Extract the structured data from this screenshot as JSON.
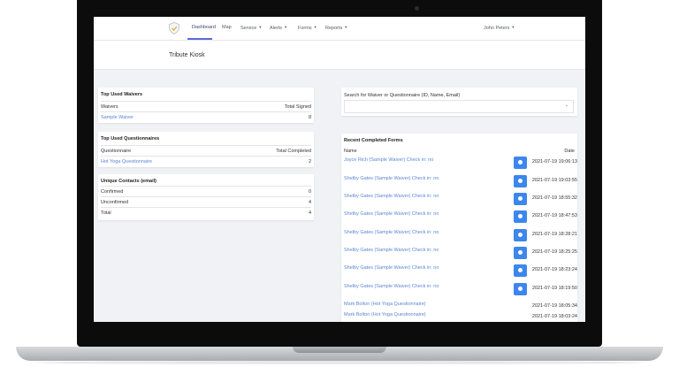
{
  "nav": {
    "items": [
      {
        "label": "Dashboard",
        "active": true
      },
      {
        "label": "Map"
      },
      {
        "label": "Service",
        "caret": true
      },
      {
        "label": "Alerts",
        "caret": true
      },
      {
        "label": "Forms",
        "caret": true
      },
      {
        "label": "Reports",
        "caret": true
      }
    ],
    "user": "John Peters"
  },
  "page_title": "Tribute Kiosk",
  "top_waivers": {
    "title": "Top Used Waivers",
    "col_name": "Waivers",
    "col_value": "Total Signed",
    "rows": [
      {
        "name": "Sample Waiver",
        "value": "8"
      }
    ]
  },
  "top_questionnaires": {
    "title": "Top Used Questionnaires",
    "col_name": "Questionnaire",
    "col_value": "Total Completed",
    "rows": [
      {
        "name": "Hot Yoga Questionnaire",
        "value": "2"
      }
    ]
  },
  "contacts": {
    "title": "Unique Contacts (email)",
    "rows": [
      {
        "name": "Confirmed",
        "value": "0"
      },
      {
        "name": "Unconfirmed",
        "value": "4"
      },
      {
        "name": "Total",
        "value": "4"
      }
    ]
  },
  "search": {
    "label": "Search for Waiver or Questionnaire (ID, Name, Email)"
  },
  "recent": {
    "title": "Recent Completed Forms",
    "col_name": "Name",
    "col_date": "Date",
    "rows": [
      {
        "name": "Joyce Rich (Sample Waiver) Check in: no",
        "date": "2021-07-19 19:06:13",
        "button": true
      },
      {
        "name": "Shelby Gates (Sample Waiver) Check in: no",
        "date": "2021-07-19 19:03:55",
        "button": true
      },
      {
        "name": "Shelby Gates (Sample Waiver) Check in: no",
        "date": "2021-07-19 18:55:32",
        "button": true
      },
      {
        "name": "Shelby Gates (Sample Waiver) Check in: no",
        "date": "2021-07-19 18:47:53",
        "button": true
      },
      {
        "name": "Shelby Gates (Sample Waiver) Check in: no",
        "date": "2021-07-19 18:28:21",
        "button": true
      },
      {
        "name": "Shelby Gates (Sample Waiver) Check in: no",
        "date": "2021-07-19 18:25:25",
        "button": true
      },
      {
        "name": "Shelby Gates (Sample Waiver) Check in: no",
        "date": "2021-07-19 18:23:24",
        "button": true
      },
      {
        "name": "Shelby Gates (Sample Waiver) Check in: no",
        "date": "2021-07-19 18:19:50",
        "button": true
      },
      {
        "name": "Mark Bolton (Hot Yoga Questionnaire)",
        "date": "2021-07-19 18:05:34",
        "button": false
      },
      {
        "name": "Mark Bolton (Hot Yoga Questionnaire)",
        "date": "2021-07-19 18:03:24",
        "button": false
      }
    ]
  },
  "colors": {
    "accent": "#3d86ee",
    "link": "#5b86d6",
    "nav_active": "#5b6bd6"
  },
  "icons": {
    "logo": "shield-check-icon",
    "row_button": "toggle-icon",
    "dropdown": "chevron-down-icon"
  }
}
